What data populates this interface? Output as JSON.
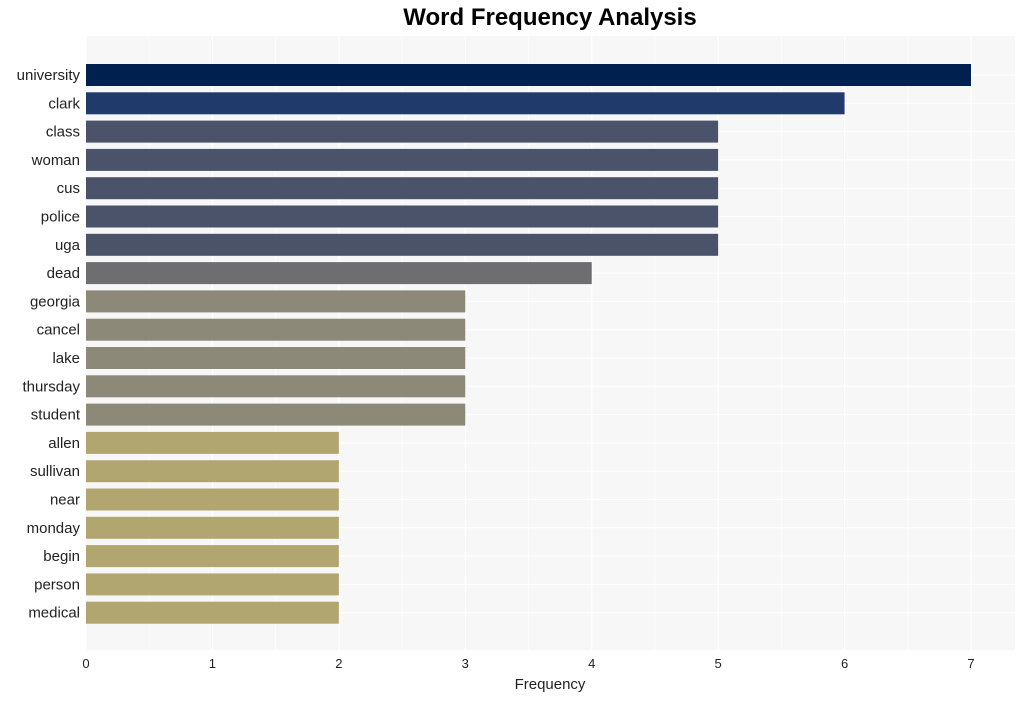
{
  "chart_data": {
    "type": "bar",
    "orientation": "horizontal",
    "title": "Word Frequency Analysis",
    "xlabel": "Frequency",
    "ylabel": "",
    "xlim": [
      0,
      7.35
    ],
    "xticks": [
      0,
      1,
      2,
      3,
      4,
      5,
      6,
      7
    ],
    "grid": true,
    "categories": [
      "university",
      "clark",
      "class",
      "woman",
      "cus",
      "police",
      "uga",
      "dead",
      "georgia",
      "cancel",
      "lake",
      "thursday",
      "student",
      "allen",
      "sullivan",
      "near",
      "monday",
      "begin",
      "person",
      "medical"
    ],
    "values": [
      7,
      6,
      5,
      5,
      5,
      5,
      5,
      4,
      3,
      3,
      3,
      3,
      3,
      2,
      2,
      2,
      2,
      2,
      2,
      2
    ],
    "colors": [
      "#00204f",
      "#213a6c",
      "#4b536b",
      "#4b536b",
      "#4b536b",
      "#4b536b",
      "#4b536b",
      "#6e6e70",
      "#8d8978",
      "#8d8978",
      "#8d8978",
      "#8d8978",
      "#8d8978",
      "#b2a670",
      "#b2a670",
      "#b2a670",
      "#b2a670",
      "#b2a670",
      "#b2a670",
      "#b2a670"
    ],
    "background": "#f7f7f7"
  }
}
